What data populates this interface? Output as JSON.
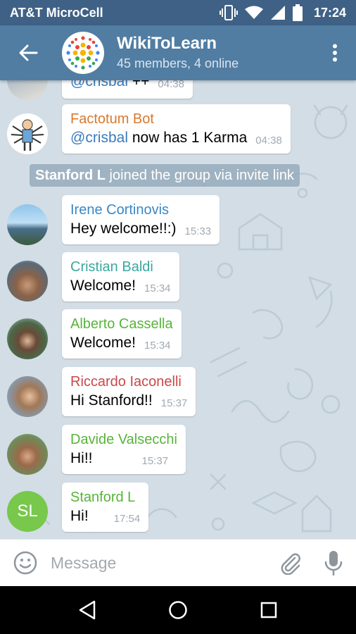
{
  "status_bar": {
    "carrier": "AT&T MicroCell",
    "time": "17:24"
  },
  "header": {
    "title": "WikiToLearn",
    "subtitle": "45 members, 4 online"
  },
  "messages": [
    {
      "mention": "@crisbal",
      "text": " ++",
      "time": "04:38"
    },
    {
      "sender": "Factotum Bot",
      "sender_color": "#d87a2c",
      "mention": "@crisbal",
      "text": " now has 1 Karma",
      "time": "04:38"
    },
    {
      "service_name": "Stanford L",
      "service_text": " joined the group via invite link"
    },
    {
      "sender": "Irene Cortinovis",
      "sender_color": "#3a87c6",
      "text": "Hey welcome!!:)",
      "time": "15:33"
    },
    {
      "sender": "Cristian Baldi",
      "sender_color": "#3aa8a0",
      "text": "Welcome!",
      "time": "15:34"
    },
    {
      "sender": "Alberto Cassella",
      "sender_color": "#58b33a",
      "text": "Welcome!",
      "time": "15:34"
    },
    {
      "sender": "Riccardo Iaconelli",
      "sender_color": "#c9484a",
      "text": "Hi Stanford!!",
      "time": "15:37"
    },
    {
      "sender": "Davide Valsecchi",
      "sender_color": "#58b33a",
      "text": "Hi!!",
      "time": "15:37"
    },
    {
      "sender": "Stanford L",
      "sender_color": "#58b33a",
      "text": "Hi!",
      "time": "17:54",
      "avatar_initials": "SL"
    }
  ],
  "input": {
    "placeholder": "Message"
  },
  "icons": [
    "back-arrow-icon",
    "more-vert-icon",
    "emoji-icon",
    "paperclip-icon",
    "microphone-icon",
    "nav-back-icon",
    "nav-home-icon",
    "nav-recents-icon"
  ]
}
